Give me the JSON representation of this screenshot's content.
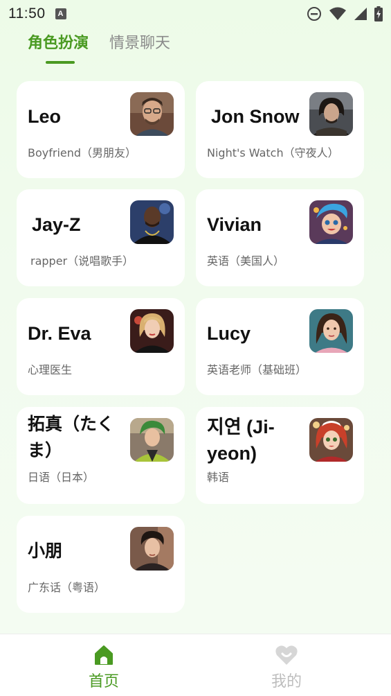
{
  "status_bar": {
    "time": "11:50",
    "icons": [
      "notification-a-icon",
      "do-not-disturb-icon",
      "wifi-icon",
      "cellular-signal-icon",
      "battery-charging-icon"
    ]
  },
  "tabs": [
    {
      "label": "角色扮演",
      "active": true
    },
    {
      "label": "情景聊天",
      "active": false
    }
  ],
  "characters": [
    {
      "name": "Leo",
      "desc": "Boyfriend（男朋友）",
      "avatar": "male-portrait-glasses"
    },
    {
      "name": "Jon Snow",
      "desc": "Night's Watch（守夜人）",
      "avatar": "jon-snow-portrait"
    },
    {
      "name": "Jay-Z",
      "desc": "rapper（说唱歌手）",
      "avatar": "rapper-portrait"
    },
    {
      "name": "Vivian",
      "desc": "英语（美国人）",
      "avatar": "cartoon-girl-blue-hair"
    },
    {
      "name": "Dr. Eva",
      "desc": "心理医生",
      "avatar": "blonde-woman-portrait"
    },
    {
      "name": "Lucy",
      "desc": "英语老师（基础班）",
      "avatar": "brunette-woman-portrait"
    },
    {
      "name": "拓真（たくま）",
      "desc": "日语（日本）",
      "avatar": "anime-boy-green-hair"
    },
    {
      "name": "지연 (Ji-yeon)",
      "desc": "韩语",
      "avatar": "cartoon-girl-red-hair"
    },
    {
      "name": "小朋",
      "desc": "广东话（粤语）",
      "avatar": "asian-man-portrait"
    }
  ],
  "bottom_nav": [
    {
      "label": "首页",
      "icon": "home-icon",
      "active": true
    },
    {
      "label": "我的",
      "icon": "profile-heart-icon",
      "active": false
    }
  ],
  "colors": {
    "accent": "#4a9a22",
    "background": "#edfbe8",
    "card": "#ffffff",
    "inactive": "#8a8a8a"
  }
}
